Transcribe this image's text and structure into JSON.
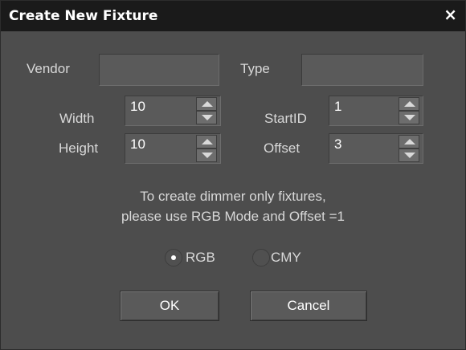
{
  "window": {
    "title": "Create New Fixture",
    "close_glyph": "×"
  },
  "fields": {
    "vendor": {
      "label": "Vendor",
      "value": ""
    },
    "type": {
      "label": "Type",
      "value": ""
    },
    "width": {
      "label": "Width",
      "value": "10"
    },
    "height": {
      "label": "Height",
      "value": "10"
    },
    "startid": {
      "label": "StartID",
      "value": "1"
    },
    "offset": {
      "label": "Offset",
      "value": "3"
    }
  },
  "info": {
    "line1": "To create dimmer only fixtures,",
    "line2": "please use RGB Mode and Offset =1"
  },
  "mode": {
    "options": [
      {
        "label": "RGB",
        "selected": true
      },
      {
        "label": "CMY",
        "selected": false
      }
    ]
  },
  "buttons": {
    "ok": "OK",
    "cancel": "Cancel"
  },
  "colors": {
    "background": "#4d4d4d",
    "titlebar": "#1a1a1a",
    "text": "#d8d8d8",
    "field": "#5a5a5a"
  },
  "icons": {
    "close": "close-icon",
    "spin_up": "spin-up-icon",
    "spin_down": "spin-down-icon"
  }
}
